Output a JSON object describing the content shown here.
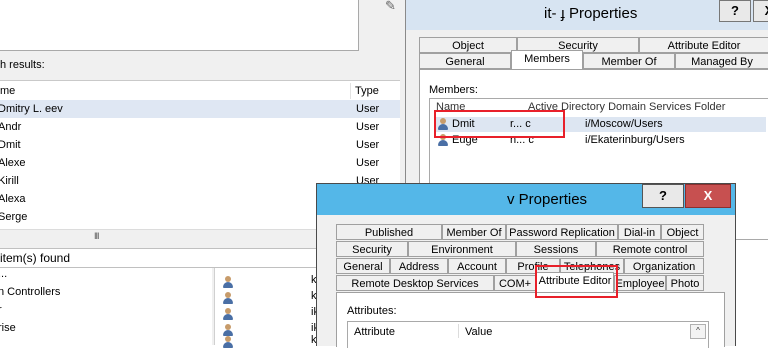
{
  "search_window": {
    "results_label": "h results:",
    "columns": {
      "name": "me",
      "type": "Type"
    },
    "rows": [
      {
        "name": "Dmitry L.          eev",
        "type": "User"
      },
      {
        "name": "Andr",
        "type": "User"
      },
      {
        "name": "Dmit",
        "type": "User"
      },
      {
        "name": "Alexe",
        "type": "User"
      },
      {
        "name": "Kirill",
        "type": "User"
      },
      {
        "name": "Alexa",
        "type": "User"
      },
      {
        "name": "Serge",
        "type": ""
      }
    ],
    "scrollbar_grip": "III",
    "status": "item(s) found",
    "tree_items": [
      "...",
      "n Controllers",
      "r",
      "rise"
    ],
    "list_items": [
      "k",
      "k",
      "ik",
      "ik",
      "ki"
    ]
  },
  "properties_window_1": {
    "title": "it-    ɟ Properties",
    "help": "?",
    "close": "X",
    "tabs_row1": [
      "Object",
      "Security",
      "Attribute Editor"
    ],
    "tabs_row2": [
      "General",
      "Members",
      "Member Of",
      "Managed By"
    ],
    "active_tab": "Members",
    "members_label": "Members:",
    "member_columns": {
      "name": "Name",
      "folder": "Active Directory Domain Services Folder"
    },
    "members": [
      {
        "name": "Dmit",
        "mid": "r...  c",
        "folder": "i/Moscow/Users"
      },
      {
        "name": "Euge",
        "mid": "n...  c",
        "folder": "i/Ekaterinburg/Users"
      }
    ]
  },
  "properties_window_2": {
    "title": "v Properties",
    "help": "?",
    "close": "X",
    "tabs_row1": [
      "Published Certificates",
      "Member Of",
      "Password Replication",
      "Dial-in",
      "Object"
    ],
    "tabs_row2": [
      "Security",
      "Environment",
      "Sessions",
      "Remote control"
    ],
    "tabs_row3": [
      "General",
      "Address",
      "Account",
      "Profile",
      "Telephones",
      "Organization"
    ],
    "tabs_row4": [
      "Remote Desktop Services Profile",
      "COM+",
      "Attribute Editor",
      "Employee",
      "Photo"
    ],
    "active_tab": "Attribute Editor",
    "attributes_label": "Attributes:",
    "attr_columns": {
      "attribute": "Attribute",
      "value": "Value"
    },
    "scroll_up": "^"
  },
  "colors": {
    "highlight_red": "#e8202a",
    "active_titlebar": "#54b7e8",
    "inactive_titlebar": "#d7e4f2",
    "close_red": "#c75050",
    "selection": "#dfe7f3"
  }
}
